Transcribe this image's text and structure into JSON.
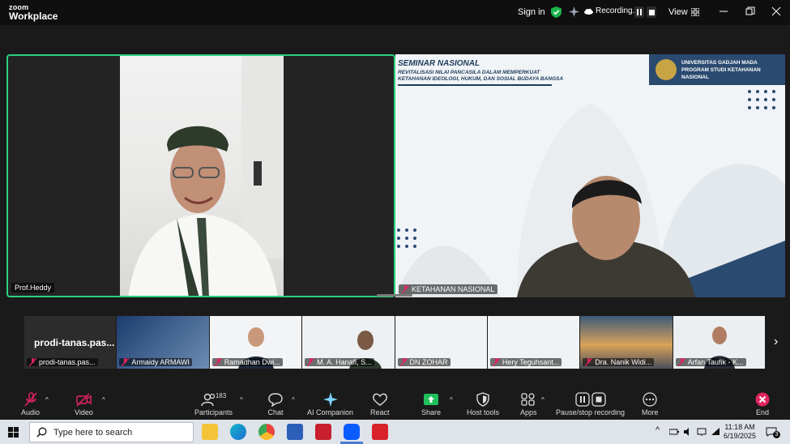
{
  "titlebar": {
    "logo_top": "zoom",
    "logo_bottom": "Workplace",
    "sign_in": "Sign in",
    "recording": "Recording...",
    "view": "View"
  },
  "speakers": [
    {
      "name": "Prof.Heddy"
    },
    {
      "name": "KETAHANAN NASIONAL"
    }
  ],
  "slide": {
    "title": "SEMINAR NASIONAL",
    "subtitle_1": "REVITALISASI NILAI PANCASILA DALAM MEMPERKUAT",
    "subtitle_2": "KETAHANAN IDEOLOGI, HUKUM, DAN SOSIAL BUDAYA BANGSA",
    "org_1": "UNIVERSITAS GADJAH MADA",
    "org_2": "PROGRAM STUDI KETAHANAN NASIONAL"
  },
  "gallery": {
    "host_big": "prodi-tanas.pas...",
    "items": [
      {
        "name": "prodi-tanas.pas..."
      },
      {
        "name": "Armaidy ARMAWI"
      },
      {
        "name": "Ramadhan Dwi..."
      },
      {
        "name": "M. A. Hanafi, S..."
      },
      {
        "name": "DN ZOHAR"
      },
      {
        "name": "Hery Teguhsant..."
      },
      {
        "name": "Dra. Nanik Widi..."
      },
      {
        "name": "Arfan Taufik - K..."
      }
    ]
  },
  "toolbar": {
    "audio": "Audio",
    "video": "Video",
    "participants": "Participants",
    "participants_count": "183",
    "chat": "Chat",
    "ai_companion": "AI Companion",
    "react": "React",
    "share": "Share",
    "host_tools": "Host tools",
    "apps": "Apps",
    "pause_stop": "Pause/stop recording",
    "more": "More",
    "end": "End"
  },
  "taskbar": {
    "search_placeholder": "Type here to search",
    "time": "11:18 AM",
    "date": "6/19/2025",
    "notifications": "3"
  },
  "colors": {
    "active_speaker_border": "#2bd17e",
    "share_green": "#20c05c",
    "end_red": "#e0245e",
    "slide_navy": "#2a4a70"
  }
}
